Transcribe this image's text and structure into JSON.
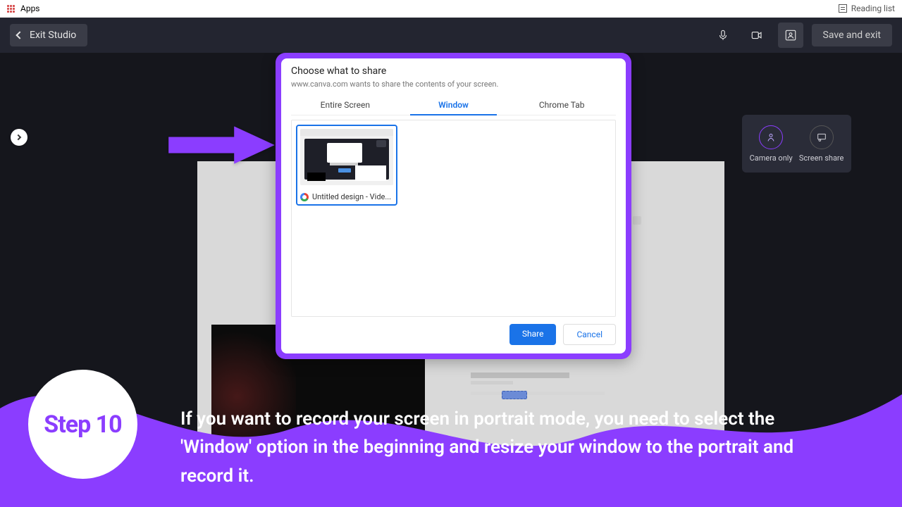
{
  "browser": {
    "apps": "Apps",
    "reading_list": "Reading list"
  },
  "appbar": {
    "exit": "Exit Studio",
    "save": "Save and exit"
  },
  "options": {
    "camera": "Camera only",
    "screen": "Screen share"
  },
  "dialog": {
    "title": "Choose what to share",
    "sub": "www.canva.com wants to share the contents of your screen.",
    "tabs": {
      "entire": "Entire Screen",
      "window": "Window",
      "chrome": "Chrome Tab"
    },
    "window_item": "Untitled design - Vide...",
    "share": "Share",
    "cancel": "Cancel"
  },
  "step": {
    "label": "Step 10",
    "text": "If you want to record your screen in portrait mode, you need to select the 'Window' option in the beginning and resize your window to the portrait and record it."
  }
}
